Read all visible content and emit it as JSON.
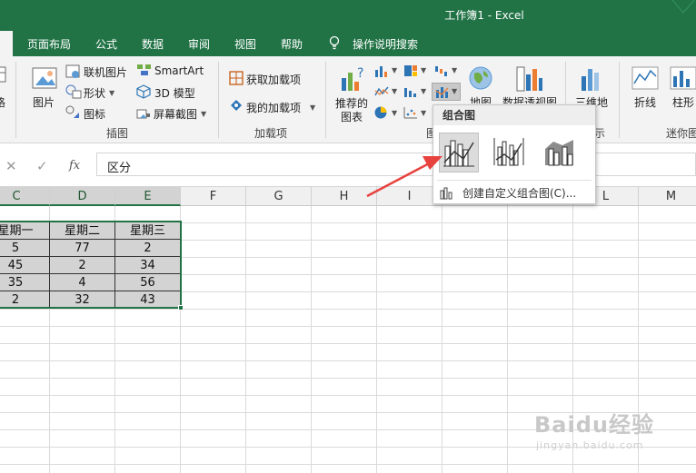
{
  "title": "工作簿1  -  Excel",
  "tabs": [
    "页面布局",
    "公式",
    "数据",
    "审阅",
    "视图",
    "帮助"
  ],
  "tell_me": "操作说明搜索",
  "ribbon": {
    "insert_left_partial": "格",
    "picture": "图片",
    "online_picture": "联机图片",
    "shapes": "形状",
    "icons": "图标",
    "smartart": "SmartArt",
    "model3d": "3D 模型",
    "screenshot": "屏幕截图",
    "group_illustrations": "插图",
    "get_addins": "获取加载项",
    "my_addins": "我的加载项",
    "group_addins": "加载项",
    "recommended_charts_1": "推荐的",
    "recommended_charts_2": "图表",
    "map": "地图",
    "pivot_chart": "数据透视图",
    "group_charts_partial": "图",
    "map3d": "三维地",
    "group_tours_partial": "示",
    "sparkline_line": "折线",
    "sparkline_column": "柱形",
    "group_sparklines": "迷你图"
  },
  "formula_bar": {
    "cancel": "✕",
    "enter": "✓",
    "fx": "fx",
    "value": "区分"
  },
  "columns": [
    "C",
    "D",
    "E",
    "F",
    "G",
    "H",
    "I",
    "J",
    "K",
    "L",
    "M"
  ],
  "table": {
    "headers": [
      "星期一",
      "星期二",
      "星期三"
    ],
    "rows": [
      [
        "5",
        "77",
        "2"
      ],
      [
        "45",
        "2",
        "34"
      ],
      [
        "35",
        "4",
        "56"
      ],
      [
        "2",
        "32",
        "43"
      ]
    ]
  },
  "dropdown": {
    "title": "组合图",
    "options": [
      "clustered-column-line-icon",
      "clustered-column-line-secondary-axis-icon",
      "stacked-area-clustered-column-icon"
    ],
    "custom": "创建自定义组合图(C)..."
  },
  "watermark": {
    "brand": "Baidu经验",
    "url": "jingyan.baidu.com"
  },
  "colors": {
    "excel_green": "#217346",
    "arrow_red": "#e8423f"
  }
}
